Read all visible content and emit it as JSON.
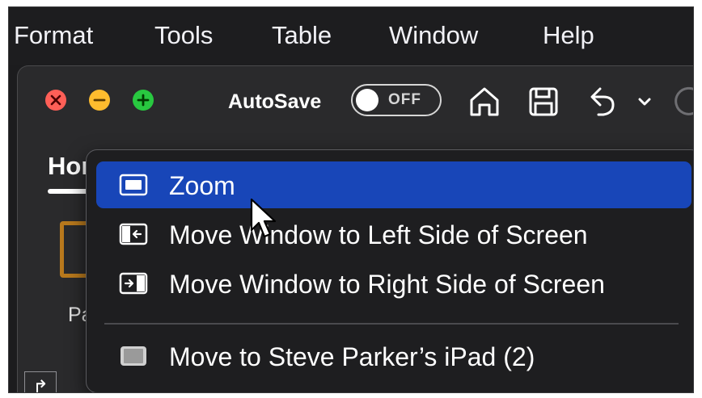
{
  "menubar": {
    "items": [
      "Format",
      "Tools",
      "Table",
      "Window",
      "Help"
    ]
  },
  "toolbar": {
    "autosave_label": "AutoSave",
    "autosave_state": "OFF"
  },
  "ribbon": {
    "home_tab_label": "Hor",
    "paste_label": "Pa"
  },
  "window_menu": {
    "items": [
      {
        "label": "Zoom",
        "icon": "zoom-window-icon",
        "highlighted": true
      },
      {
        "label": "Move Window to Left Side of Screen",
        "icon": "tile-left-icon"
      },
      {
        "label": "Move Window to Right Side of Screen",
        "icon": "tile-right-icon"
      },
      {
        "label": "Move to Steve Parker’s iPad (2)",
        "icon": "ipad-icon"
      }
    ]
  },
  "colors": {
    "highlight": "#1846b8",
    "close": "#ff5f57",
    "minimize": "#febc2e",
    "zoom": "#28c840",
    "paste_orange": "#b8791d"
  }
}
